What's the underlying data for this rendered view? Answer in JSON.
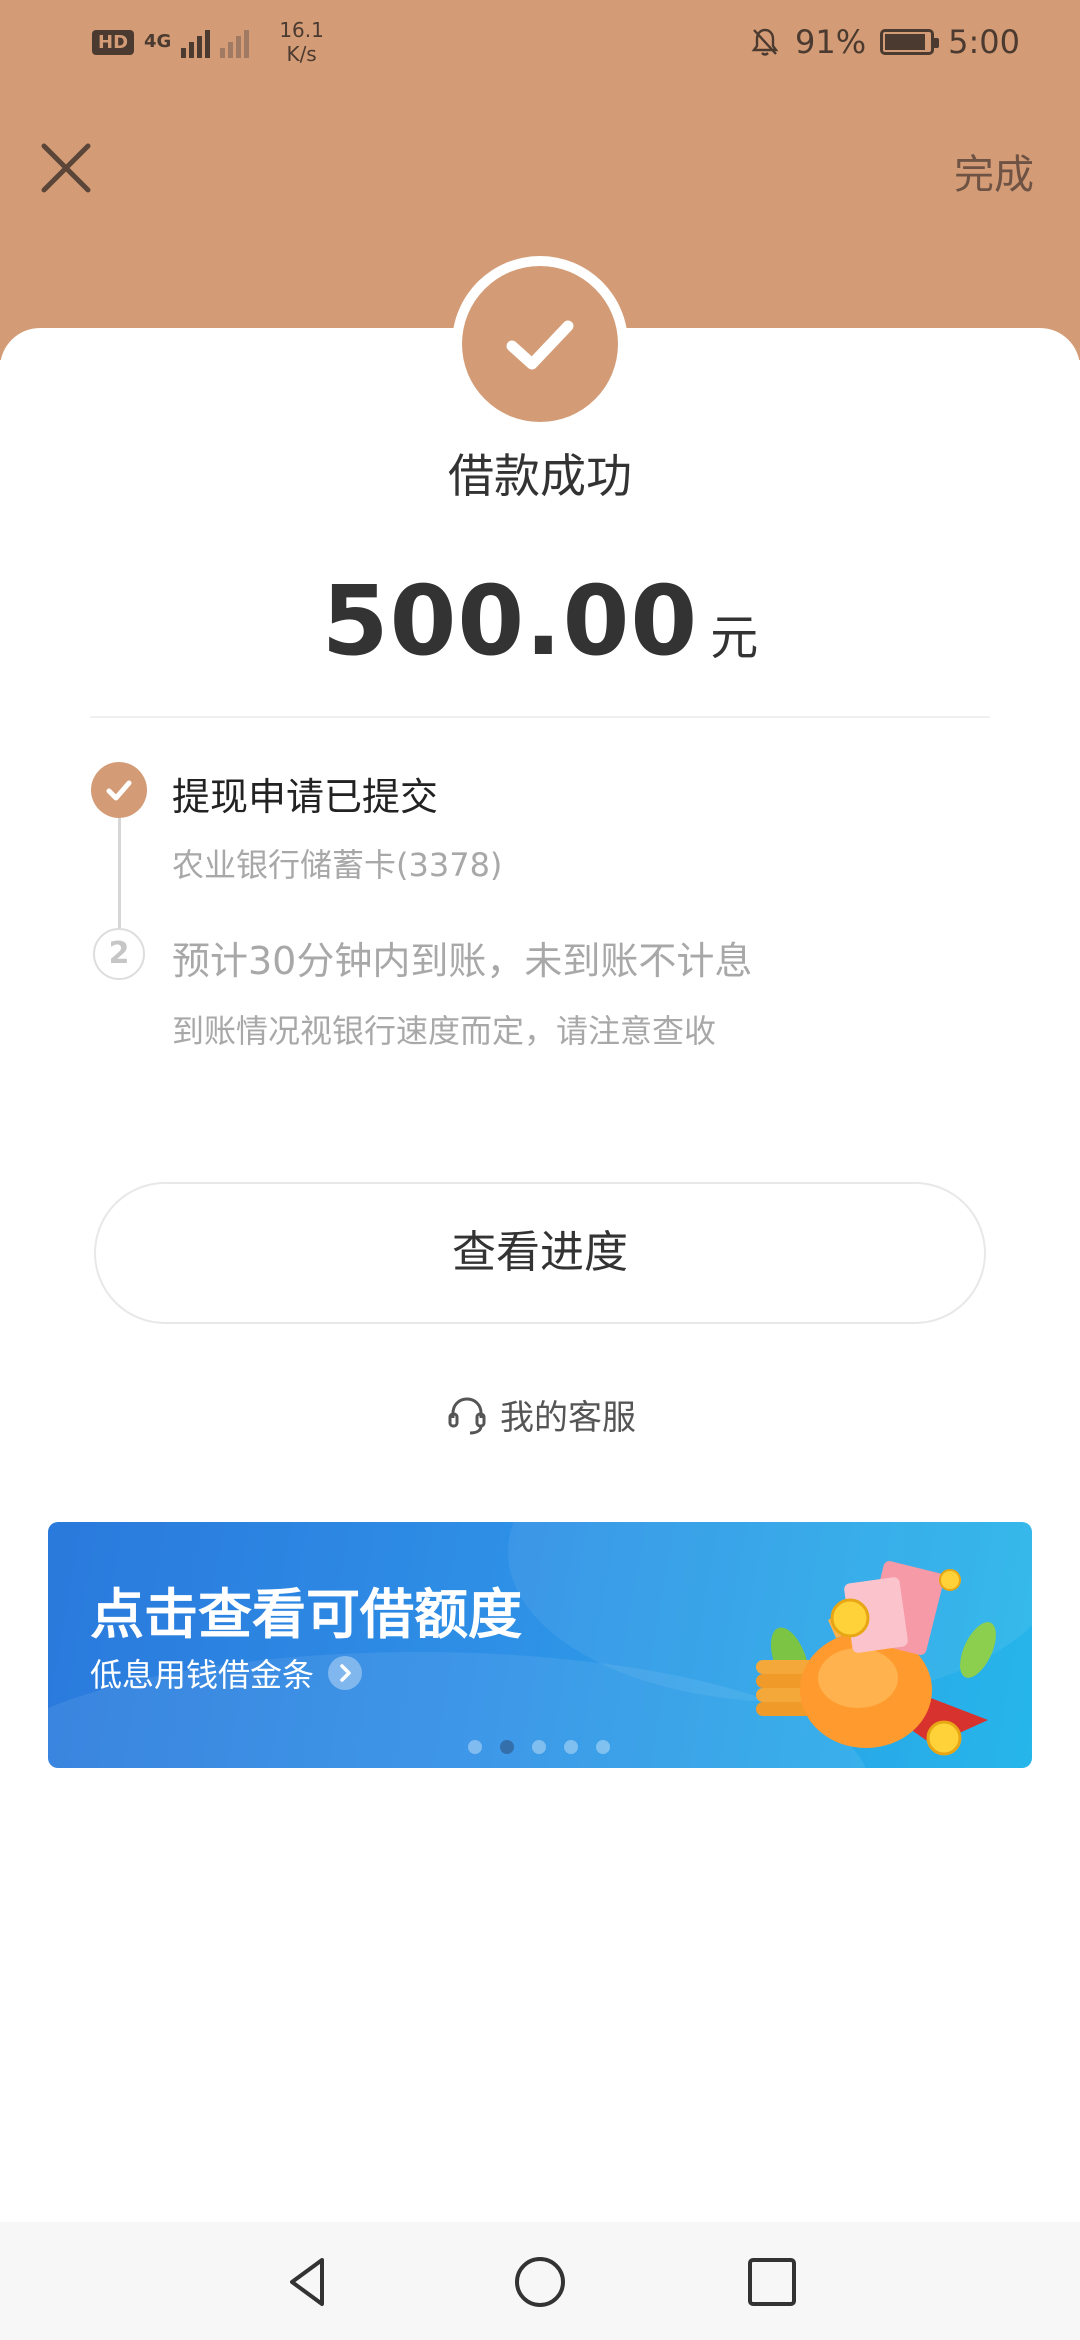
{
  "status_bar": {
    "hd_label": "HD",
    "network_label": "4G",
    "speed_value": "16.1",
    "speed_unit": "K/s",
    "battery_percent": "91%",
    "battery_level": 0.91,
    "time": "5:00"
  },
  "header": {
    "done_label": "完成",
    "background_color": "#d49c76"
  },
  "result": {
    "title": "借款成功",
    "amount": "500.00",
    "unit": "元"
  },
  "steps": [
    {
      "number": "",
      "title": "提现申请已提交",
      "subtitle": "农业银行储蓄卡(3378)",
      "state": "done"
    },
    {
      "number": "2",
      "title": "预计30分钟内到账，未到账不计息",
      "subtitle": "到账情况视银行速度而定，请注意查收",
      "state": "pending"
    }
  ],
  "progress_button": {
    "label": "查看进度"
  },
  "service": {
    "label": "我的客服",
    "icon": "headset-icon"
  },
  "banner": {
    "title": "点击查看可借额度",
    "subtitle": "低息用钱借金条",
    "active_index": 1,
    "slide_count": 5
  },
  "colors": {
    "accent": "#d49c76",
    "banner_start": "#2a79dc",
    "banner_end": "#26b6ea"
  }
}
